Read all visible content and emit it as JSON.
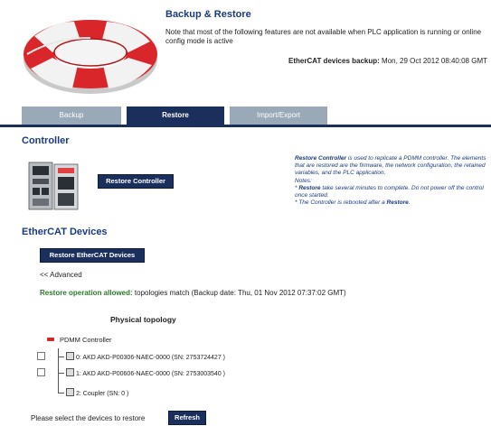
{
  "header": {
    "title": "Backup & Restore",
    "note": "Note that most of the following features are not available when PLC application is running or online config mode is active",
    "backup_label": "EtherCAT devices backup:",
    "backup_value": "Mon, 29 Oct 2012 08:40:08 GMT"
  },
  "tabs": [
    {
      "label": "Backup"
    },
    {
      "label": "Restore"
    },
    {
      "label": "Import/Export"
    }
  ],
  "controller": {
    "heading": "Controller",
    "button": "Restore Controller",
    "side_note": {
      "intro_bold": "Restore Controller",
      "intro_rest": " is used to replicate a PDMM controller. The elements that are restored are the firmware, the network configuration, the retained variables, and the PLC application.",
      "notes_label": "Notes:",
      "note1_prefix": "* ",
      "note1_bold": "Restore",
      "note1_rest": " take several minutes to complete. Do not power off the control once started.",
      "note2_prefix": "* The Controller is rebooted after a ",
      "note2_bold": "Restore",
      "note2_suffix": "."
    }
  },
  "ethercat": {
    "heading": "EtherCAT Devices",
    "button": "Restore EtherCAT Devices",
    "advanced": "<< Advanced",
    "restore_ok": "Restore operation allowed:",
    "restore_detail": " topologies match (Backup date: Thu, 01 Nov 2012 07:37:02 GMT)"
  },
  "topology": {
    "title": "Physical topology",
    "root": "PDMM Controller",
    "nodes": [
      {
        "label": "0: AKD AKD-P00306-NAEC-0000 (SN: 2753724427 )"
      },
      {
        "label": "1: AKD AKD-P00606-NAEC-0000 (SN: 2753003540 )"
      },
      {
        "label": "2: Coupler (SN: 0 )"
      }
    ]
  },
  "footer": {
    "select_label": "Please select the devices to restore",
    "refresh": "Refresh"
  }
}
